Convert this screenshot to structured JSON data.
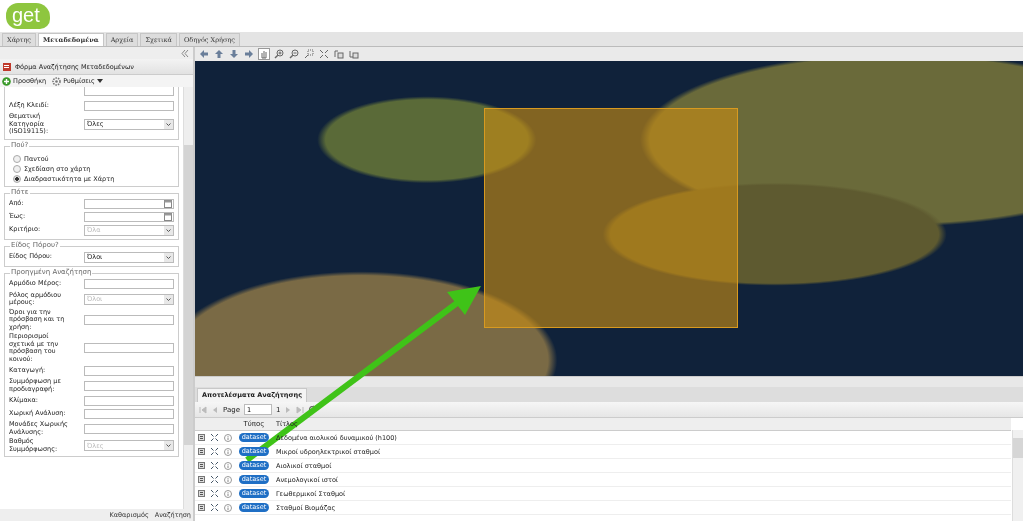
{
  "logo": {
    "text": "get"
  },
  "tabs": [
    {
      "label": "Χάρτης",
      "selected": false
    },
    {
      "label": "Μεταδεδομένα",
      "selected": true
    },
    {
      "label": "Αρχεία",
      "selected": false
    },
    {
      "label": "Σχετικά",
      "selected": false
    },
    {
      "label": "Οδηγός Χρήσης",
      "selected": false
    }
  ],
  "form_panel": {
    "title": "Φόρμα Αναζήτησης Μεταδεδομένων",
    "toolbar": [
      {
        "kind": "add",
        "label": "Προσθήκη"
      },
      {
        "kind": "settings",
        "label": "Ρυθμίσεις"
      }
    ],
    "basic_fields": [
      {
        "kind": "text",
        "label": "Λέξη Κλειδί:"
      },
      {
        "kind": "select",
        "label": "Θεματική Κατηγορία (ISO19115):",
        "value": "Όλες",
        "disabled": false
      }
    ],
    "where": {
      "legend": "Πού?",
      "options": [
        {
          "label": "Παντού",
          "selected": false
        },
        {
          "label": "Σχεδίαση στο χάρτη",
          "selected": false
        },
        {
          "label": "Διαδραστικότητα με Χάρτη",
          "selected": true
        }
      ]
    },
    "when": {
      "legend": "Πότε",
      "fields": [
        {
          "kind": "date",
          "label": "Από:"
        },
        {
          "kind": "date",
          "label": "Έως:"
        },
        {
          "kind": "select",
          "label": "Κριτήριο:",
          "value": "Όλα",
          "disabled": true
        }
      ]
    },
    "resource_type": {
      "legend": "Είδος Πόρου?",
      "fields": [
        {
          "kind": "select",
          "label": "Είδος Πόρου:",
          "value": "Όλοι",
          "disabled": false
        }
      ]
    },
    "advanced": {
      "legend": "Προηγμένη Αναζήτηση",
      "fields": [
        {
          "kind": "text",
          "label": "Αρμόδιο Μέρος:"
        },
        {
          "kind": "select",
          "label": "Ρόλος αρμόδιου μέρους:",
          "value": "Όλοι",
          "disabled": true
        },
        {
          "kind": "text",
          "label": "Όροι για την πρόσβαση και τη χρήση:"
        },
        {
          "kind": "text",
          "label": "Περιορισμοί σχετικά με την πρόσβαση του κοινού:"
        },
        {
          "kind": "text",
          "label": "Καταγωγή:"
        },
        {
          "kind": "text",
          "label": "Συμμόρφωση με προδιαγραφή:"
        },
        {
          "kind": "text",
          "label": "Κλίμακα:"
        },
        {
          "kind": "text",
          "label": "Χωρική Ανάλυση:"
        },
        {
          "kind": "text",
          "label": "Μονάδες Χωρικής Ανάλυσης:"
        },
        {
          "kind": "select",
          "label": "Βαθμός Συμμόρφωσης:",
          "value": "Όλες",
          "disabled": true
        }
      ]
    },
    "buttons": [
      "Καθαρισμός",
      "Αναζήτηση"
    ]
  },
  "map_tools": [
    {
      "kind": "left",
      "selected": false
    },
    {
      "kind": "up",
      "selected": false
    },
    {
      "kind": "down",
      "selected": false
    },
    {
      "kind": "right",
      "selected": false
    },
    {
      "kind": "pan",
      "selected": true
    },
    {
      "kind": "zoom-in",
      "selected": false
    },
    {
      "kind": "zoom-out",
      "selected": false
    },
    {
      "kind": "zoom-box",
      "selected": false
    },
    {
      "kind": "extent",
      "selected": false
    },
    {
      "kind": "prev",
      "selected": false
    },
    {
      "kind": "next",
      "selected": false
    }
  ],
  "results": {
    "title": "Αποτελέσματα Αναζήτησης",
    "pager": {
      "label": "Page",
      "page": "1",
      "total": "1"
    },
    "columns": [
      "Τύπος",
      "Τίτλος"
    ],
    "rows": [
      {
        "type": "dataset",
        "title": "Δεδομένα αιολικού δυναμικού (h100)"
      },
      {
        "type": "dataset",
        "title": "Μικροί υδροηλεκτρικοί σταθμοί"
      },
      {
        "type": "dataset",
        "title": "Αιολικοί σταθμοί"
      },
      {
        "type": "dataset",
        "title": "Ανεμολογικοί ιστοί"
      },
      {
        "type": "dataset",
        "title": "Γεωθερμικοί Σταθμοί"
      },
      {
        "type": "dataset",
        "title": "Σταθμοί Βιομάζας"
      }
    ]
  }
}
